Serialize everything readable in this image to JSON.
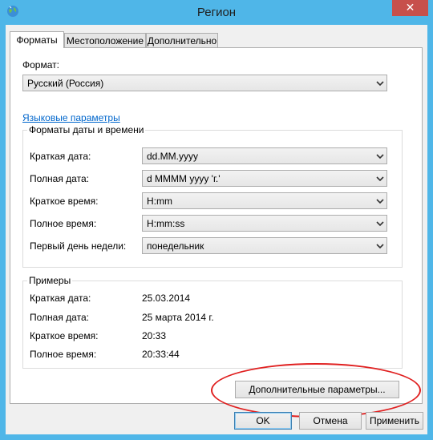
{
  "window": {
    "title": "Регион",
    "close_glyph": "✕"
  },
  "tabs": [
    {
      "label": "Форматы",
      "active": true
    },
    {
      "label": "Местоположение",
      "active": false
    },
    {
      "label": "Дополнительно",
      "active": false
    }
  ],
  "format": {
    "label": "Формат:",
    "value": "Русский (Россия)"
  },
  "language_link": "Языковые параметры",
  "datetime": {
    "legend": "Форматы даты и времени",
    "rows": [
      {
        "label": "Краткая дата:",
        "value": "dd.MM.yyyy"
      },
      {
        "label": "Полная дата:",
        "value": "d MMMM yyyy 'г.'"
      },
      {
        "label": "Краткое время:",
        "value": "H:mm"
      },
      {
        "label": "Полное время:",
        "value": "H:mm:ss"
      },
      {
        "label": "Первый день недели:",
        "value": "понедельник"
      }
    ]
  },
  "examples": {
    "legend": "Примеры",
    "rows": [
      {
        "label": "Краткая дата:",
        "value": "25.03.2014"
      },
      {
        "label": "Полная дата:",
        "value": "25 марта 2014 г."
      },
      {
        "label": "Краткое время:",
        "value": "20:33"
      },
      {
        "label": "Полное время:",
        "value": "20:33:44"
      }
    ]
  },
  "advanced_button": "Дополнительные параметры...",
  "buttons": {
    "ok": "OK",
    "cancel": "Отмена",
    "apply": "Применить"
  },
  "colors": {
    "frame": "#4fb6e8",
    "close": "#c7504c",
    "link": "#0066cc",
    "highlight": "#e02020"
  }
}
